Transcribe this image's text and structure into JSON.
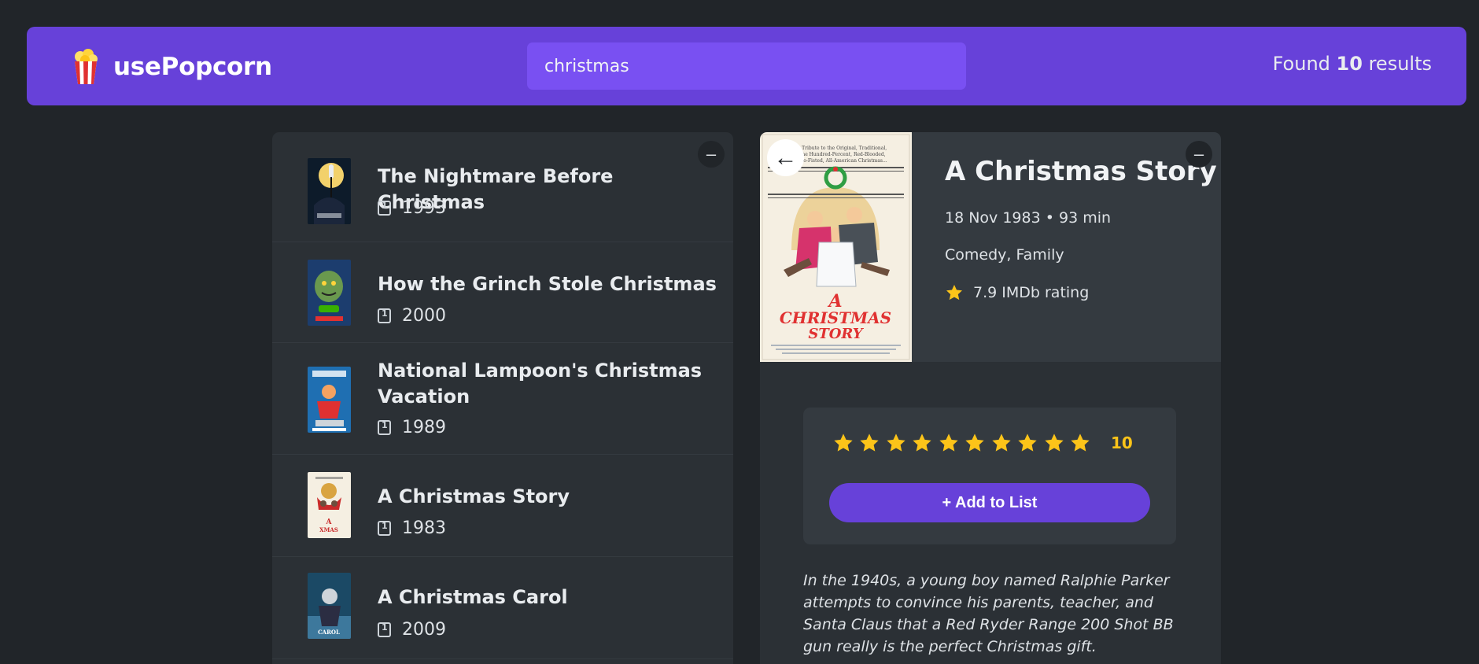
{
  "nav": {
    "logo_text": "usePopcorn",
    "search_value": "christmas",
    "results_prefix": "Found",
    "results_count": "10",
    "results_suffix": "results"
  },
  "list": {
    "toggle_label": "–",
    "movies": [
      {
        "title": "The Nightmare Before Christmas",
        "year": "1993"
      },
      {
        "title": "How the Grinch Stole Christmas",
        "year": "2000"
      },
      {
        "title": "National Lampoon's Christmas Vacation",
        "year": "1989"
      },
      {
        "title": "A Christmas Story",
        "year": "1983"
      },
      {
        "title": "A Christmas Carol",
        "year": "2009"
      }
    ]
  },
  "detail": {
    "toggle_label": "–",
    "back_label": "←",
    "title": "A Christmas Story",
    "released_runtime": "18 Nov 1983 • 93 min",
    "genre": "Comedy, Family",
    "imdb_rating": "7.9 IMDb rating",
    "user_rating": "10",
    "star_total": 10,
    "add_label": "+ Add to List",
    "plot": "In the 1940s, a young boy named Ralphie Parker attempts to convince his parents, teacher, and Santa Claus that a Red Ryder Range 200 Shot BB gun really is the perfect Christmas gift.",
    "poster_text": {
      "tagline": "A Tribute to the Original, Traditional, One Hundred-Percent, Red-Blooded, Two-Fisted, All-American Christmas...",
      "title": "A CHRISTMAS STORY"
    }
  },
  "colors": {
    "background": "#212529",
    "nav": "#6741d9",
    "search": "#7950f2",
    "panel": "#2b3035",
    "panel_light": "#343a40",
    "star": "#fcc419"
  }
}
